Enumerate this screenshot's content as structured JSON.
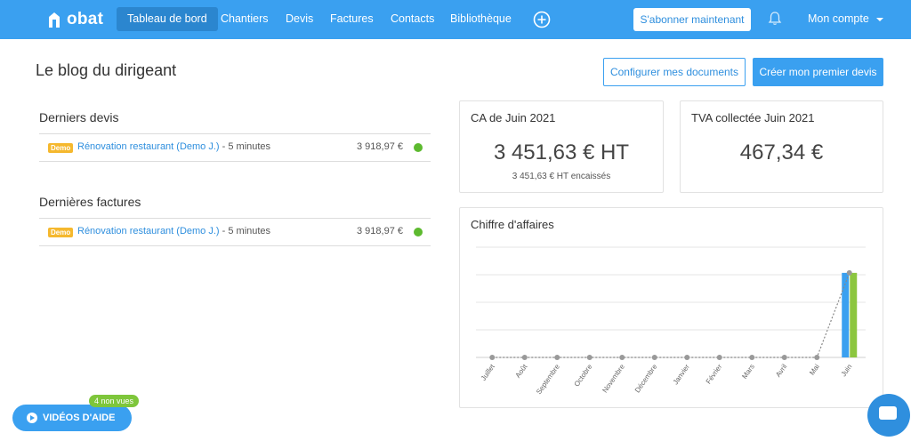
{
  "brand": {
    "name": "obat"
  },
  "nav": {
    "items": [
      {
        "label": "Tableau de bord",
        "active": true
      },
      {
        "label": "Chantiers",
        "active": false
      },
      {
        "label": "Devis",
        "active": false
      },
      {
        "label": "Factures",
        "active": false
      },
      {
        "label": "Contacts",
        "active": false
      },
      {
        "label": "Bibliothèque",
        "active": false
      }
    ],
    "add_icon": "plus-circle-icon",
    "subscribe_label": "S'abonner maintenant",
    "notification_icon": "bell-icon",
    "account_label": "Mon compte"
  },
  "header": {
    "title": "Le blog du dirigeant",
    "configure_button": "Configurer mes documents",
    "create_button": "Créer mon premier devis"
  },
  "quotes": {
    "title": "Derniers devis",
    "items": [
      {
        "badge": "Demo",
        "name": "Rénovation restaurant (Demo J.)",
        "time": " - 5 minutes",
        "amount": "3 918,97 €",
        "status_color": "#5dba2f"
      }
    ]
  },
  "invoices": {
    "title": "Dernières factures",
    "items": [
      {
        "badge": "Demo",
        "name": "Rénovation restaurant (Demo J.)",
        "time": " - 5 minutes",
        "amount": "3 918,97 €",
        "status_color": "#5dba2f"
      }
    ]
  },
  "kpi": {
    "revenue_title": "CA de Juin 2021",
    "revenue_value": "3 451,63 € HT",
    "revenue_sub": "3 451,63 € HT encaissés",
    "vat_title": "TVA collectée Juin 2021",
    "vat_value": "467,34 €"
  },
  "chart_card": {
    "title": "Chiffre d'affaires"
  },
  "chart_data": {
    "type": "bar",
    "title": "Chiffre d'affaires",
    "categories": [
      "Juillet",
      "Août",
      "Septembre",
      "Octobre",
      "Novembre",
      "Décembre",
      "Janvier",
      "Février",
      "Mars",
      "Avril",
      "Mai",
      "Juin"
    ],
    "series": [
      {
        "values": [
          0,
          0,
          0,
          0,
          0,
          0,
          0,
          0,
          0,
          0,
          0,
          3451.63
        ],
        "color": "#3aa0f0"
      },
      {
        "values": [
          0,
          0,
          0,
          0,
          0,
          0,
          0,
          0,
          0,
          0,
          0,
          3451.63
        ],
        "color": "#8cc63f"
      }
    ],
    "line": {
      "values": [
        0,
        0,
        0,
        0,
        0,
        0,
        0,
        0,
        0,
        0,
        0,
        3451.63
      ],
      "color": "#888888",
      "style": "dotted"
    },
    "ylim": [
      0,
      4500
    ],
    "grid": true,
    "xlabel": "",
    "ylabel": ""
  },
  "help": {
    "label": "VIDÉOS D'AIDE",
    "badge": "4 non vues",
    "chat_icon": "chat-icon"
  },
  "colors": {
    "primary": "#3aa0f0",
    "demo": "#f5b82e",
    "success": "#5dba2f"
  }
}
